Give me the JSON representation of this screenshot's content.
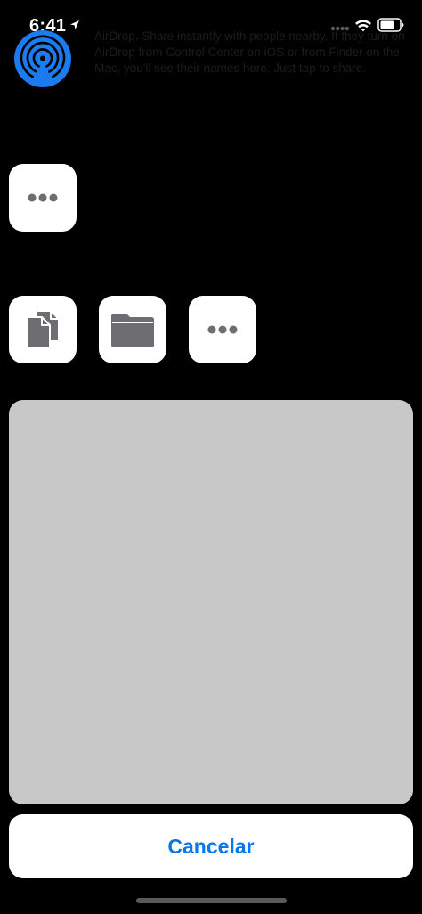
{
  "status_bar": {
    "time": "6:41",
    "icons": [
      "location-arrow-icon",
      "cellular-signal-icon",
      "wifi-icon",
      "battery-icon"
    ]
  },
  "airdrop": {
    "icon": "airdrop-icon",
    "text": "AirDrop. Share instantly with people nearby. If they turn on AirDrop from Control Center on iOS or from Finder on the Mac, you'll see their names here. Just tap to share."
  },
  "share_row": {
    "items": [
      {
        "icon": "more-dots-icon"
      }
    ]
  },
  "action_row": {
    "items": [
      {
        "icon": "copy-documents-icon"
      },
      {
        "icon": "folder-icon"
      },
      {
        "icon": "more-dots-icon"
      }
    ]
  },
  "cancel": {
    "label": "Cancelar"
  },
  "colors": {
    "background": "#000000",
    "tile": "#ffffff",
    "icon_glyph": "#6d6d72",
    "preview": "#c8c8c8",
    "accent": "#0a76e8",
    "airdrop_blue": "#1b7cf0"
  }
}
